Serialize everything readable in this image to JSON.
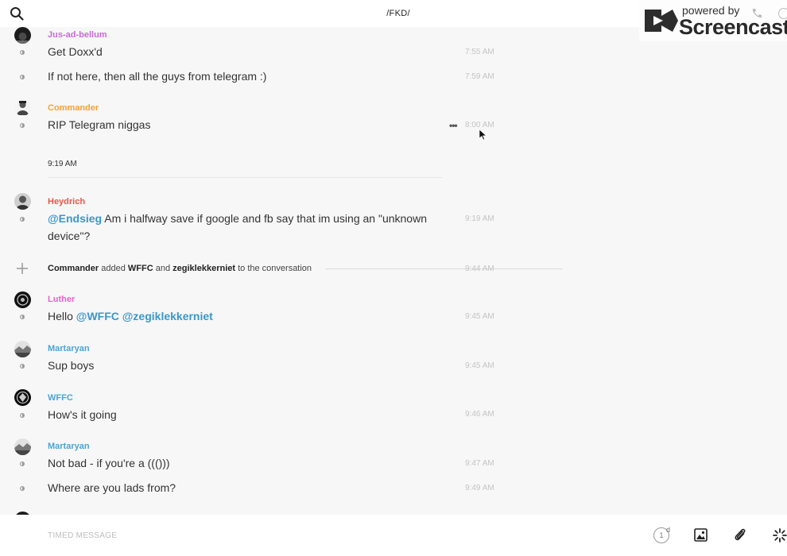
{
  "header": {
    "title": "/FKD/",
    "search_icon": "search-icon"
  },
  "watermark": {
    "powered": "powered by",
    "brand": "Screencastify"
  },
  "messages": [
    {
      "sender": "Jus-ad-bellum",
      "sender_color": "#c86bd6",
      "text": "Get Doxx'd",
      "time": "7:55 AM"
    },
    {
      "text": "If not here, then all the guys from telegram :)",
      "time": "7:59 AM"
    },
    {
      "sender": "Commander",
      "sender_color": "#f2a33a",
      "text": "RIP Telegram niggas",
      "time": "8:00 AM"
    },
    {
      "sender": "Heydrich",
      "sender_color": "#e8574f",
      "mention": "@Endsieg",
      "text": " Am i halfway save if google and fb say that im using an \"unknown device\"?",
      "time": "9:19 AM"
    },
    {
      "sender": "Luther",
      "sender_color": "#e866c7",
      "text": "Hello ",
      "mention1": "@WFFC",
      "mention2": "@zegiklekkerniet",
      "time": "9:45 AM"
    },
    {
      "sender": "Martaryan",
      "sender_color": "#4aa6d4",
      "text": "Sup boys",
      "time": "9:45 AM"
    },
    {
      "sender": "WFFC",
      "sender_color": "#4aa6d4",
      "text": "How's it going",
      "time": "9:46 AM"
    },
    {
      "sender": "Martaryan",
      "sender_color": "#4aa6d4",
      "text": "Not bad - if you're a ((()))",
      "time": "9:47 AM"
    },
    {
      "text": "Where are you lads from?",
      "time": "9:49 AM"
    }
  ],
  "day_separator": "9:19 AM",
  "system_event": {
    "actor": "Commander",
    "verb": "added",
    "user1": "WFFC",
    "conj": "and",
    "user2": "zegiklekkerniet",
    "suffix": "to the conversation",
    "time": "9:44 AM"
  },
  "composer": {
    "placeholder": "TIMED MESSAGE",
    "timer_value": "1",
    "timer_unit": "d"
  },
  "colors": {
    "mention": "#3a98c9",
    "background": "#f7f7f7"
  }
}
